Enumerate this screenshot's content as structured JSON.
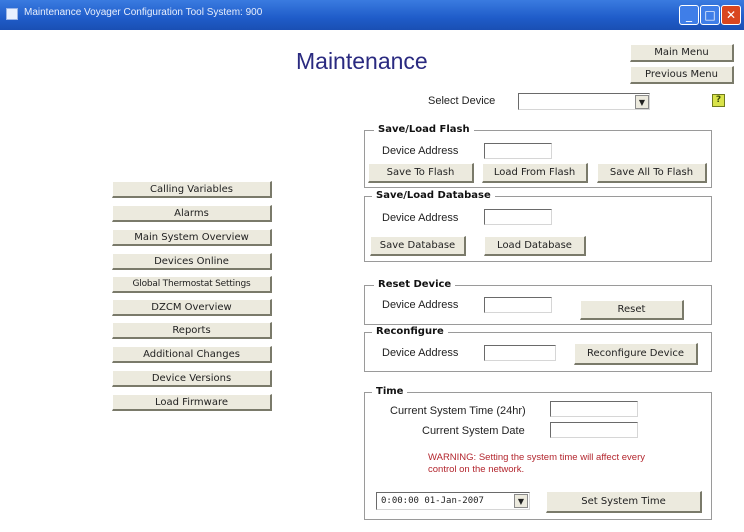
{
  "window": {
    "title": "Maintenance  Voyager Configuration Tool  System: 900",
    "minimize_glyph": "_",
    "maximize_glyph": "□",
    "close_glyph": "✕"
  },
  "page": {
    "title": "Maintenance",
    "main_menu": "Main Menu",
    "previous_menu": "Previous Menu",
    "help_glyph": "?",
    "select_device_label": "Select Device",
    "select_device_value": ""
  },
  "nav": {
    "items": [
      "Calling Variables",
      "Alarms",
      "Main System Overview",
      "Devices Online",
      "Global Thermostat Settings",
      "DZCM Overview",
      "Reports",
      "Additional Changes",
      "Device Versions",
      "Load Firmware"
    ]
  },
  "flash": {
    "title": "Save/Load Flash",
    "device_address_label": "Device Address",
    "device_address_value": "",
    "save_to_flash": "Save To Flash",
    "load_from_flash": "Load From Flash",
    "save_all_to_flash": "Save All To Flash"
  },
  "database": {
    "title": "Save/Load Database",
    "device_address_label": "Device Address",
    "device_address_value": "",
    "save_database": "Save Database",
    "load_database": "Load Database"
  },
  "reset": {
    "title": "Reset Device",
    "device_address_label": "Device Address",
    "device_address_value": "",
    "reset": "Reset"
  },
  "reconfigure": {
    "title": "Reconfigure",
    "device_address_label": "Device Address",
    "device_address_value": "",
    "reconfigure_device": "Reconfigure Device"
  },
  "time": {
    "title": "Time",
    "current_time_label": "Current System Time (24hr)",
    "current_time_value": "",
    "current_date_label": "Current System Date",
    "current_date_value": "",
    "warning": "WARNING: Setting the system time will affect every control on the network.",
    "datetime_value": "0:00:00 01-Jan-2007",
    "combo_arrow": "▼",
    "set_system_time": "Set System Time"
  },
  "colors": {
    "warning": "#b3262e",
    "title": "#2a2a80",
    "titlebar": "#1f5cc9",
    "button_face": "#eceade"
  }
}
